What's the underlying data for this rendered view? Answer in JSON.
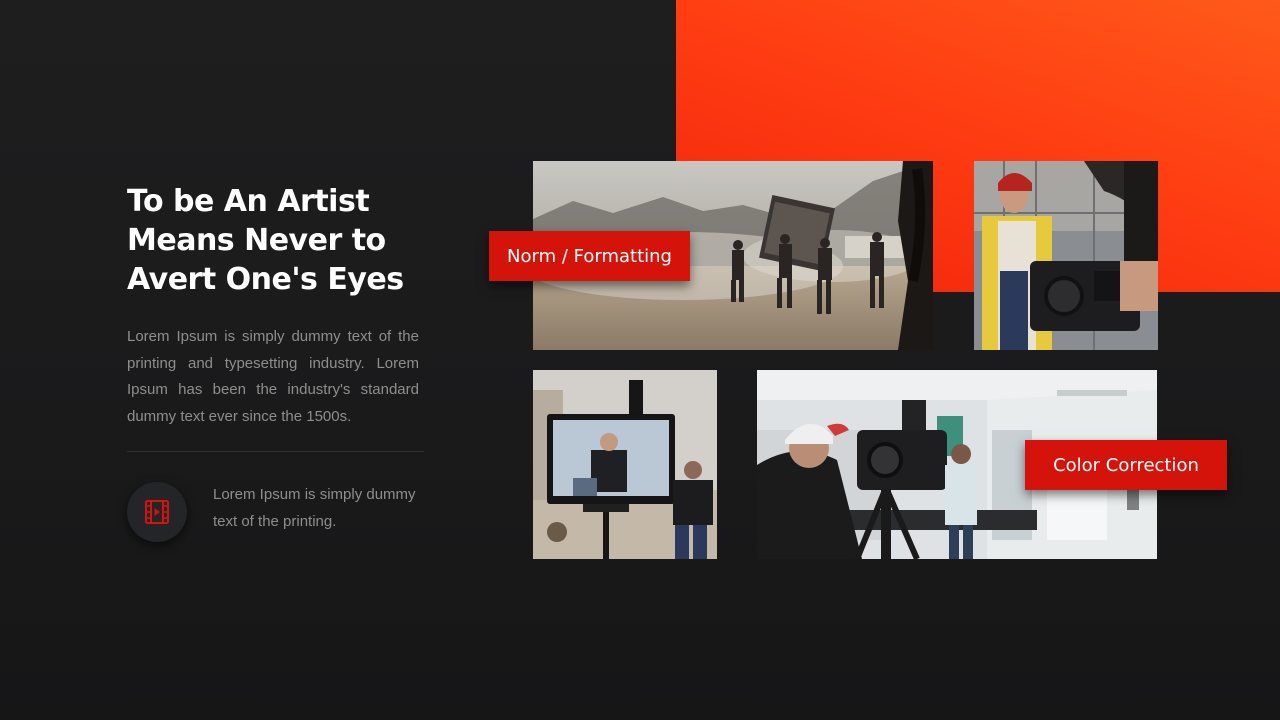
{
  "slide": {
    "title_lines": [
      "To be An Artist",
      "Means Never to",
      "Avert One's Eyes"
    ],
    "body_text": "Lorem Ipsum is simply dummy text of the printing and typesetting industry.  Lorem Ipsum has been the industry's standard dummy text ever since the 1500s.",
    "feature": {
      "icon": "film-strip-icon",
      "text": "Lorem Ipsum is simply dummy text of the printing."
    }
  },
  "labels": {
    "norm_formatting": "Norm / Formatting",
    "color_correction": "Color Correction"
  },
  "colors": {
    "background": "#1c1c1d",
    "accent_orange": "#ff4a16",
    "label_red": "#d4140b",
    "title": "#ffffff",
    "body": "#8e8e8e"
  }
}
